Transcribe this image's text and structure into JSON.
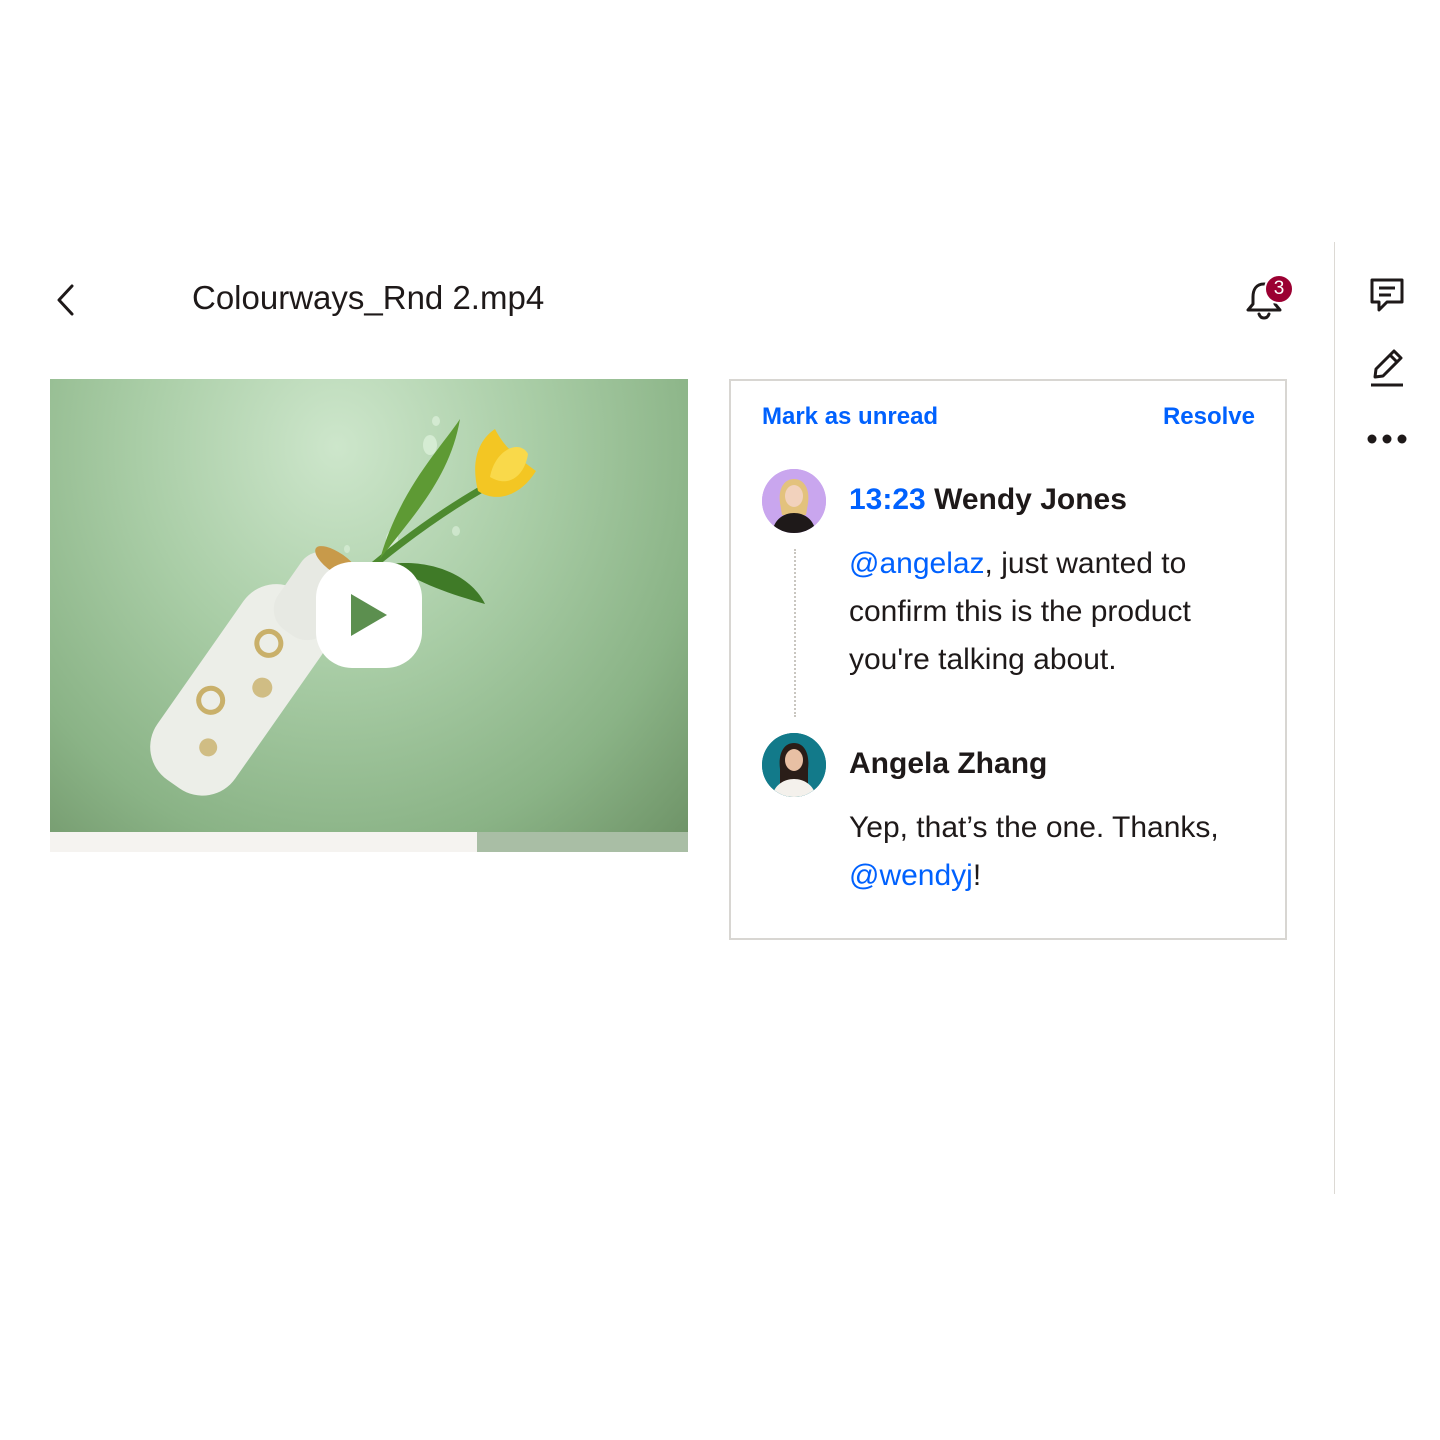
{
  "header": {
    "back_icon": "chevron-left-icon",
    "file_name": "Colourways_Rnd 2.mp4",
    "notifications": {
      "icon": "bell-icon",
      "count": "3",
      "badge_color": "#9b0032"
    }
  },
  "sidebar": {
    "items": [
      {
        "icon": "comment-icon"
      },
      {
        "icon": "pencil-icon"
      },
      {
        "icon": "more-horizontal-icon"
      }
    ]
  },
  "video": {
    "play_icon": "play-icon",
    "progress_fraction": 0.67
  },
  "comment_panel": {
    "mark_unread_label": "Mark as unread",
    "resolve_label": "Resolve",
    "accent_color": "#0061fe",
    "comments": [
      {
        "timestamp": "13:23",
        "author": "Wendy Jones",
        "mention": "@angelaz",
        "text": ", just wanted to confirm this is the product you're talking about."
      },
      {
        "author": "Angela Zhang",
        "text_before": "Yep, that’s the one. Thanks, ",
        "mention": "@wendyj",
        "text_after": "!"
      }
    ]
  }
}
